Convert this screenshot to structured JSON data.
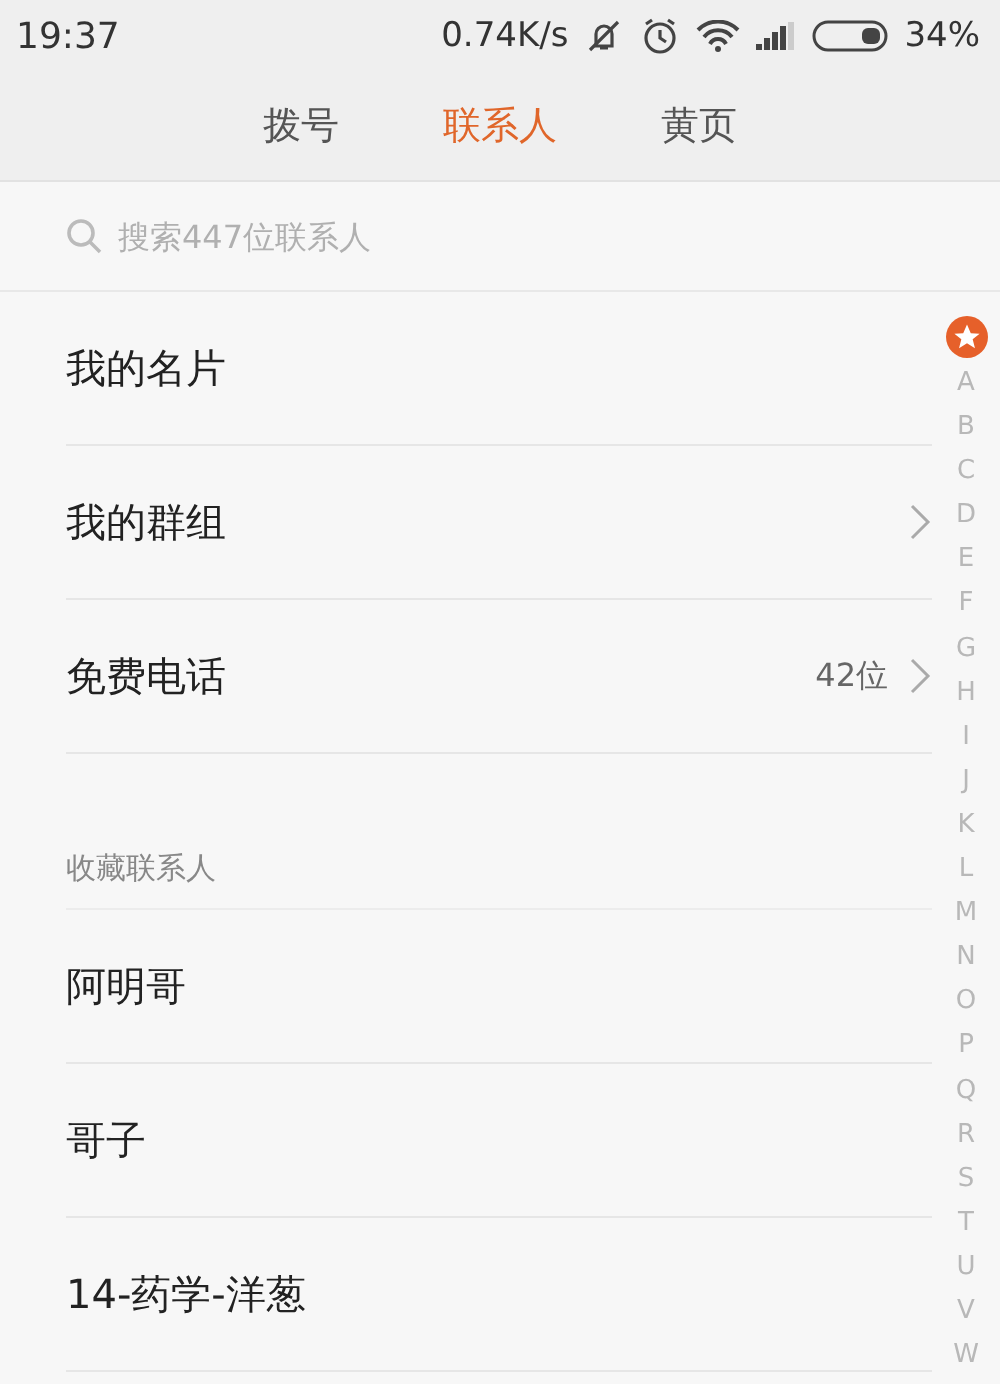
{
  "status_bar": {
    "time": "19:37",
    "speed": "0.74K/s",
    "battery": "34%"
  },
  "tabs": [
    {
      "label": "拨号",
      "selected": false
    },
    {
      "label": "联系人",
      "selected": true
    },
    {
      "label": "黄页",
      "selected": false
    }
  ],
  "search": {
    "placeholder": "搜索447位联系人"
  },
  "list": [
    {
      "kind": "row",
      "label": "我的名片",
      "has_arrow": false
    },
    {
      "kind": "row",
      "label": "我的群组",
      "has_arrow": true
    },
    {
      "kind": "row",
      "label": "免费电话",
      "count": "42位",
      "has_arrow": true
    },
    {
      "kind": "header",
      "label": "收藏联系人"
    },
    {
      "kind": "row",
      "label": "阿明哥",
      "has_arrow": false
    },
    {
      "kind": "row",
      "label": "哥子",
      "has_arrow": false
    },
    {
      "kind": "row",
      "label": "14-药学-洋葱",
      "has_arrow": false
    }
  ],
  "index": [
    "A",
    "B",
    "C",
    "D",
    "E",
    "F",
    "G",
    "H",
    "I",
    "J",
    "K",
    "L",
    "M",
    "N",
    "O",
    "P",
    "Q",
    "R",
    "S",
    "T",
    "U",
    "V",
    "W"
  ]
}
